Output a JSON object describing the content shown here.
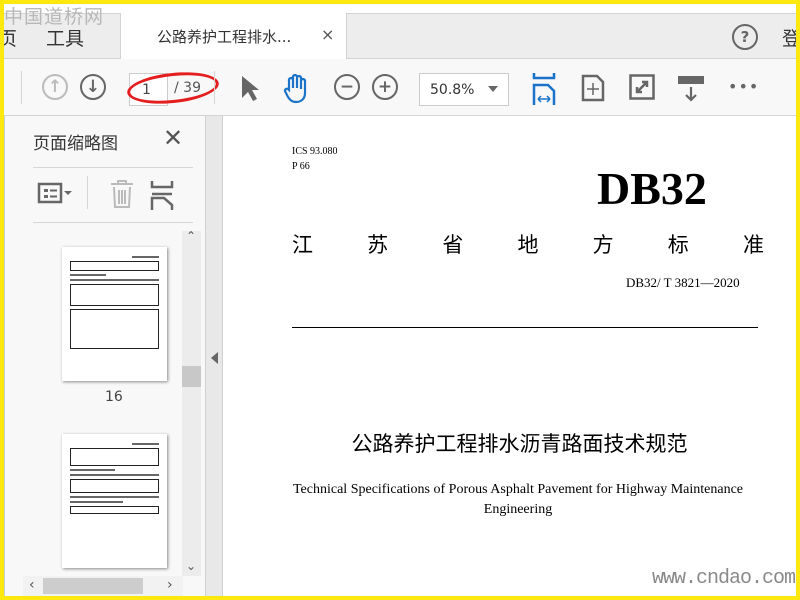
{
  "watermark": {
    "top": "中国道桥网",
    "bottom": "www.cndao.com"
  },
  "tabbar": {
    "home_partial": "页",
    "tools": "工具",
    "tab_title": "公路养护工程排水...",
    "tab_close": "×",
    "help": "?",
    "login_partial": "登"
  },
  "toolbar": {
    "page_current": "1",
    "page_total": "/ 39",
    "zoom": "50.8%",
    "more": "•••",
    "icons": [
      "arrow-up-icon",
      "arrow-down-icon",
      "select-pointer-icon",
      "hand-tool-icon",
      "zoom-out-icon",
      "zoom-in-icon",
      "fit-width-icon",
      "fit-page-icon",
      "full-screen-icon",
      "scroll-mode-icon",
      "more-icon"
    ]
  },
  "sidebar": {
    "title": "页面缩略图",
    "close": "✕",
    "page_label": "16"
  },
  "document": {
    "ics": "ICS 93.080",
    "p": "P 66",
    "db": "DB32",
    "province": [
      "江",
      "苏",
      "省",
      "地",
      "方",
      "标",
      "准"
    ],
    "code": "DB32/ T 3821—2020",
    "title_cn": "公路养护工程排水沥青路面技术规范",
    "title_en": "Technical Specifications of Porous Asphalt Pavement for Highway Maintenance Engineering"
  },
  "colors": {
    "accent": "#1a73c8",
    "annotation": "#e41e1e",
    "border": "#fde910"
  }
}
